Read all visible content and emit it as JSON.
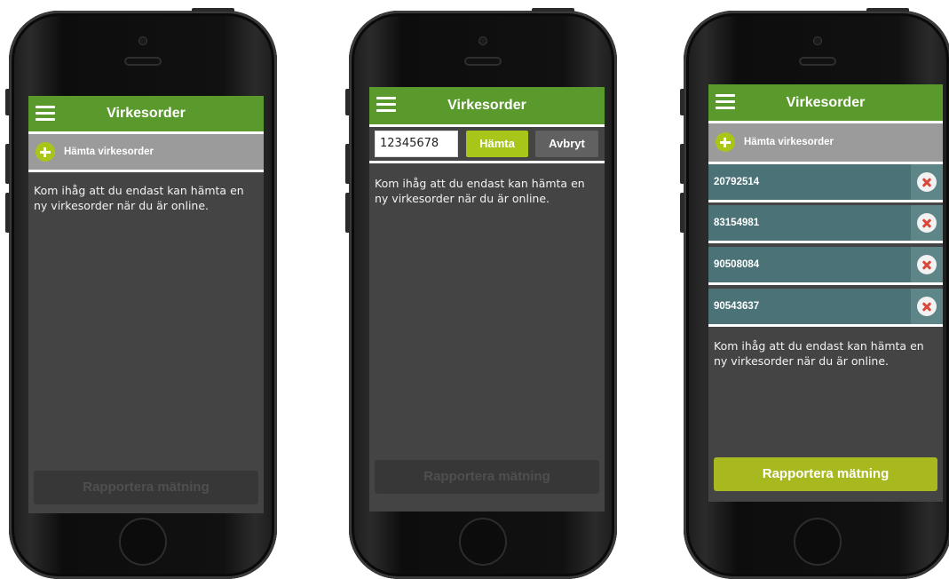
{
  "app": {
    "title": "Virkesorder",
    "fetch_label": "Hämta virkesorder",
    "info_text": "Kom ihåg att du endast kan hämta en ny virkesorder när du är online.",
    "report_button": "Rapportera mätning"
  },
  "screen2": {
    "input_value": "12345678",
    "fetch_button": "Hämta",
    "cancel_button": "Avbryt"
  },
  "screen3": {
    "orders": [
      {
        "number": "20792514"
      },
      {
        "number": "83154981"
      },
      {
        "number": "90508084"
      },
      {
        "number": "90543637"
      }
    ]
  },
  "colors": {
    "appbar": "#5a9a2c",
    "accent": "#a8c61a",
    "order_row": "#4b7276",
    "delete": "#d9483b",
    "screen_bg": "#444444"
  },
  "icons": [
    "menu-icon",
    "plus-icon",
    "delete-icon"
  ]
}
